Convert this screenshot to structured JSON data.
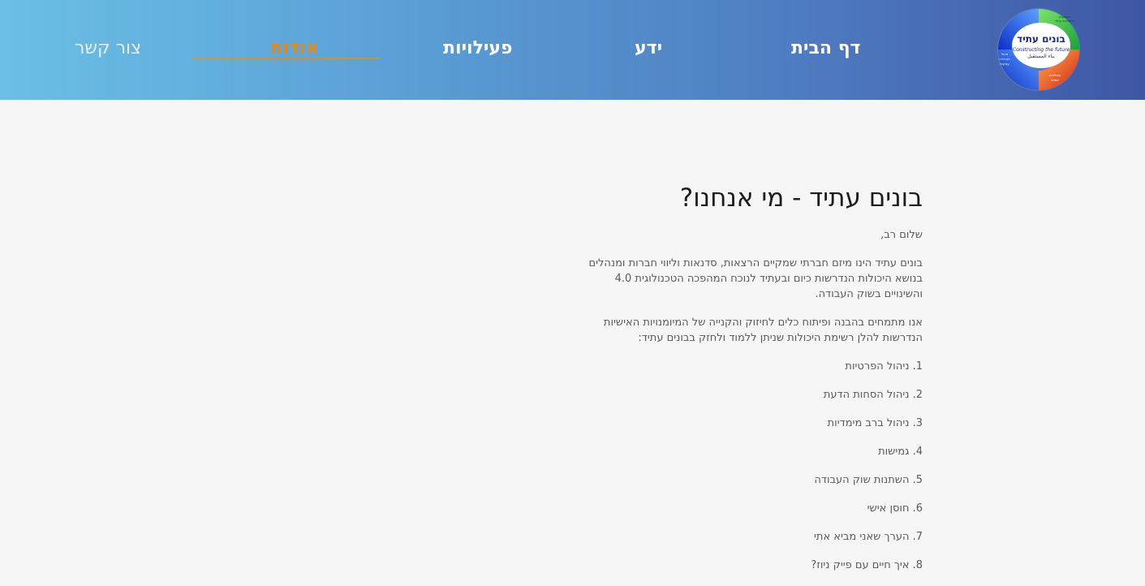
{
  "header": {
    "logo": {
      "title": "בונים עתיד",
      "subtitle_en": "Constructing the future",
      "subtitle_ar": "بناء المستقبل",
      "segment_top": "אמצעים",
      "segment_top2": "מיומנויות עתיד",
      "segment_left": "ניהול",
      "segment_left2": "הבחירה",
      "segment_left3": "עסקית",
      "segment_bottom": "תהליכים",
      "segment_bottom2": "יזמיים",
      "colors": [
        "#2db34a",
        "#1e4fd6",
        "#e2401f"
      ]
    },
    "nav": {
      "home": "דף הבית",
      "knowledge": "ידע",
      "activities": "פעילויות",
      "about": "אודות",
      "contact": "צור קשר"
    },
    "accent_color": "#e08a1c"
  },
  "main": {
    "title": "בונים עתיד - מי אנחנו?",
    "greeting": "שלום רב,",
    "intro_lines": [
      "בונים עתיד הינו מיזם חברתי שמקיים הרצאות, סדנאות וליווי חברות ומנהלים",
      "בנושא היכולות הנדרשות כיום ובעתיד לנוכח המהפכה הטכנולוגית 4.0",
      "והשינויים בשוק העבודה."
    ],
    "focus_lines": [
      "אנו מתמחים בהבנה ופיתוח כלים לחיזוק והקנייה של המיומנויות האישיות",
      "הנדרשות להלן רשימת היכולות שניתן ללמוד ולחזק בבונים עתיד:"
    ],
    "list": [
      "1. ניהול הפרטיות",
      "2. ניהול הסחות הדעת",
      "3. ניהול ברב מימדיות",
      "4. גמישות",
      "5. השתנות שוק העבודה",
      "6. חוסן אישי",
      "7. הערך שאני מביא אתי",
      "8. איך חיים עם פייק ניוז?"
    ]
  }
}
